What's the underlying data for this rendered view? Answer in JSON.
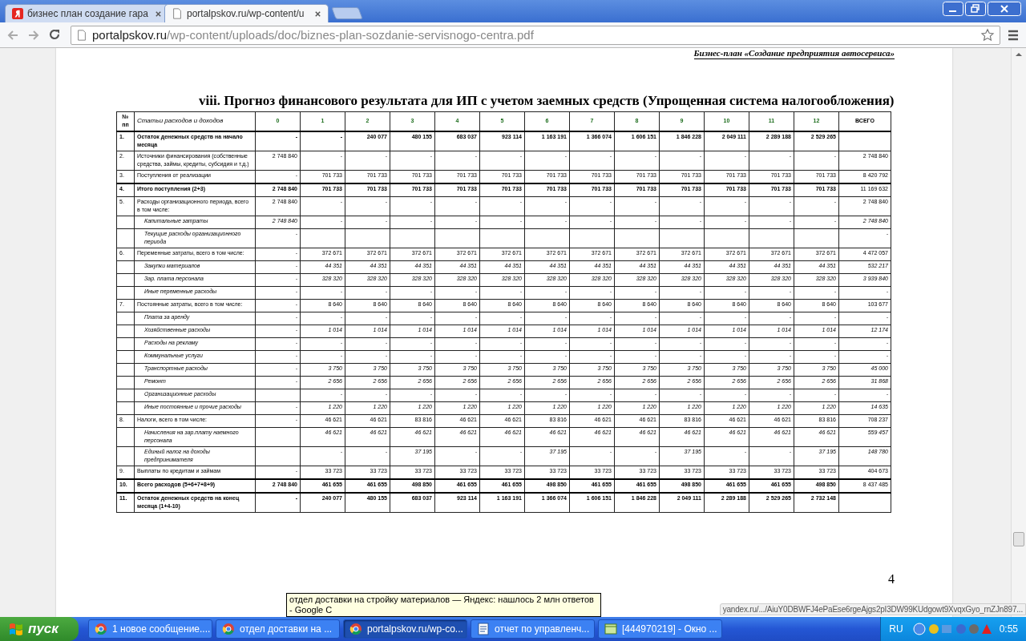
{
  "browser": {
    "tabs": [
      {
        "title": "бизнес план создание гара",
        "kind": "yandex",
        "selected": false
      },
      {
        "title": "portalpskov.ru/wp-content/u",
        "kind": "page",
        "selected": true
      }
    ],
    "address": {
      "host": "portalpskov.ru",
      "path": "/wp-content/uploads/doc/biznes-plan-sozdanie-servisnogo-centra.pdf"
    }
  },
  "document": {
    "running_header": "Бизнес-план «Создание предприятия автосервиса»",
    "title": "viii. Прогноз финансового результата для ИП с учетом заемных средств (Упрощенная система налогообложения)",
    "table": {
      "number_header": "№ пп",
      "label_header": "Статьи расходов и доходов",
      "columns": [
        "0",
        "1",
        "2",
        "3",
        "4",
        "5",
        "6",
        "7",
        "8",
        "9",
        "10",
        "11",
        "12"
      ],
      "total_header": "ВСЕГО",
      "rows": [
        {
          "number": "1.",
          "label": "Остаток денежных средств на начало месяца",
          "kind": "total",
          "values": [
            "-",
            "-",
            "240 077",
            "480 155",
            "683 037",
            "923 114",
            "1 163 191",
            "1 366 074",
            "1 606 151",
            "1 846 228",
            "2 049 111",
            "2 289 188",
            "2 529 265"
          ]
        },
        {
          "number": "2.",
          "label": "Источники финансирования (собственные средства, займы, кредиты, субсидия и т.д.)",
          "kind": "section",
          "values": [
            "2 748 840",
            "-",
            "-",
            "-",
            "-",
            "-",
            "-",
            "-",
            "-",
            "-",
            "-",
            "-",
            "-"
          ],
          "total": "2 748 840"
        },
        {
          "number": "3.",
          "label": "Поступления от реализации",
          "kind": "section",
          "values": [
            "-",
            "701 733",
            "701 733",
            "701 733",
            "701 733",
            "701 733",
            "701 733",
            "701 733",
            "701 733",
            "701 733",
            "701 733",
            "701 733",
            "701 733"
          ],
          "total": "8 420 792"
        },
        {
          "number": "4.",
          "label": "Итого поступления (2+3)",
          "kind": "total",
          "values": [
            "2 748 840",
            "701 733",
            "701 733",
            "701 733",
            "701 733",
            "701 733",
            "701 733",
            "701 733",
            "701 733",
            "701 733",
            "701 733",
            "701 733",
            "701 733"
          ],
          "total": "11 169 632"
        },
        {
          "number": "5.",
          "label": "Расходы организационного периода, всего в том числе:",
          "kind": "section",
          "values": [
            "2 748 840",
            "-",
            "-",
            "-",
            "-",
            "-",
            "-",
            "-",
            "-",
            "-",
            "-",
            "-",
            "-"
          ],
          "total": "2 748 840"
        },
        {
          "number": null,
          "label": "Капитальные затраты",
          "kind": "item",
          "values": [
            "2 748 840",
            "-",
            "-",
            "-",
            "-",
            "-",
            "-",
            "-",
            "-",
            "-",
            "-",
            "-",
            "-"
          ],
          "total": "2 748 840"
        },
        {
          "number": null,
          "label": "Текущие расходы организационного периода",
          "kind": "item",
          "values": [
            "-",
            {
              "blank": true
            },
            {
              "blank": true
            },
            {
              "blank": true
            },
            {
              "blank": true
            },
            {
              "blank": true
            },
            {
              "blank": true
            },
            {
              "blank": true
            },
            {
              "blank": true
            },
            {
              "blank": true
            },
            {
              "blank": true
            },
            {
              "blank": true
            },
            {
              "blank": true
            }
          ],
          "total": "-"
        },
        {
          "number": "6.",
          "label": "Переменные затраты, всего в том числе:",
          "kind": "section",
          "values": [
            "-",
            "372 671",
            "372 671",
            "372 671",
            "372 671",
            "372 671",
            "372 671",
            "372 671",
            "372 671",
            "372 671",
            "372 671",
            "372 671",
            "372 671"
          ],
          "total": "4 472 057"
        },
        {
          "number": null,
          "label": "Закупки материалов",
          "kind": "item",
          "values": [
            "-",
            "44 351",
            "44 351",
            "44 351",
            "44 351",
            "44 351",
            "44 351",
            "44 351",
            "44 351",
            "44 351",
            "44 351",
            "44 351",
            "44 351"
          ],
          "total": "532 217"
        },
        {
          "number": null,
          "label": "Зар. плата персонала",
          "kind": "item",
          "values": [
            "-",
            "328 320",
            "328 320",
            "328 320",
            "328 320",
            "328 320",
            "328 320",
            "328 320",
            "328 320",
            "328 320",
            "328 320",
            "328 320",
            "328 320"
          ],
          "total": "3 939 840"
        },
        {
          "number": null,
          "label": "Иные переменные расходы",
          "kind": "item",
          "values": [
            "-",
            "-",
            "-",
            "-",
            "-",
            "-",
            "-",
            "-",
            "-",
            "-",
            "-",
            "-",
            "-"
          ],
          "total": "-"
        },
        {
          "number": "7.",
          "label": "Постоянные затраты, всего в том числе:",
          "kind": "section",
          "values": [
            "-",
            "8 640",
            "8 640",
            "8 640",
            "8 640",
            "8 640",
            "8 640",
            "8 640",
            "8 640",
            "8 640",
            "8 640",
            "8 640",
            "8 640"
          ],
          "total": "103 677"
        },
        {
          "number": null,
          "label": "Плата за аренду",
          "kind": "item",
          "values": [
            "-",
            "-",
            "-",
            "-",
            "-",
            "-",
            "-",
            "-",
            "-",
            "-",
            "-",
            "-",
            "-"
          ],
          "total": "-"
        },
        {
          "number": null,
          "label": "Хозяйственные расходы",
          "kind": "item",
          "values": [
            "-",
            "1 014",
            "1 014",
            "1 014",
            "1 014",
            "1 014",
            "1 014",
            "1 014",
            "1 014",
            "1 014",
            "1 014",
            "1 014",
            "1 014"
          ],
          "total": "12 174"
        },
        {
          "number": null,
          "label": "Расходы на рекламу",
          "kind": "item",
          "values": [
            "-",
            "-",
            "-",
            "-",
            "-",
            "-",
            "-",
            "-",
            "-",
            "-",
            "-",
            "-",
            "-"
          ],
          "total": "-"
        },
        {
          "number": null,
          "label": "Коммунальные услуги",
          "kind": "item",
          "values": [
            "-",
            "-",
            "-",
            "-",
            "-",
            "-",
            "-",
            "-",
            "-",
            "-",
            "-",
            "-",
            "-"
          ],
          "total": "-"
        },
        {
          "number": null,
          "label": "Транспортные расходы",
          "kind": "item",
          "values": [
            "-",
            "3 750",
            "3 750",
            "3 750",
            "3 750",
            "3 750",
            "3 750",
            "3 750",
            "3 750",
            "3 750",
            "3 750",
            "3 750",
            "3 750"
          ],
          "total": "45 000"
        },
        {
          "number": null,
          "label": "Ремонт",
          "kind": "item",
          "values": [
            "-",
            "2 656",
            "2 656",
            "2 656",
            "2 656",
            "2 656",
            "2 656",
            "2 656",
            "2 656",
            "2 656",
            "2 656",
            "2 656",
            "2 656"
          ],
          "total": "31 868"
        },
        {
          "number": null,
          "label": "Организационные расходы",
          "kind": "item",
          "values": [
            {
              "blank": true
            },
            "-",
            "-",
            "-",
            "-",
            "-",
            "-",
            "-",
            "-",
            "-",
            "-",
            "-",
            "-"
          ],
          "total": "-"
        },
        {
          "number": null,
          "label": "Иные постоянные и прочие расходы",
          "kind": "item",
          "values": [
            "-",
            "1 220",
            "1 220",
            "1 220",
            "1 220",
            "1 220",
            "1 220",
            "1 220",
            "1 220",
            "1 220",
            "1 220",
            "1 220",
            "1 220"
          ],
          "total": "14 635"
        },
        {
          "number": "8.",
          "label": "Налоги, всего в том числе:",
          "kind": "section",
          "values": [
            "-",
            "46 621",
            "46 621",
            "83 816",
            "46 621",
            "46 621",
            "83 816",
            "46 621",
            "46 621",
            "83 816",
            "46 621",
            "46 621",
            "83 816"
          ],
          "total": "708 237"
        },
        {
          "number": null,
          "label": "Начисления на зар.плату наемного персонала",
          "kind": "item",
          "values": [
            {
              "blank": true
            },
            "46 621",
            "46 621",
            "46 621",
            "46 621",
            "46 621",
            "46 621",
            "46 621",
            "46 621",
            "46 621",
            "46 621",
            "46 621",
            "46 621"
          ],
          "total": "559 457"
        },
        {
          "number": null,
          "label": "Единый налог на доходы предпринимателя",
          "kind": "item",
          "values": [
            {
              "blank": true
            },
            "-",
            "-",
            "37 195",
            "-",
            "-",
            "37 195",
            "-",
            "-",
            "37 195",
            "-",
            "-",
            "37 195"
          ],
          "total": "148 780"
        },
        {
          "number": "9.",
          "label": "Выплаты по кредитам и займам",
          "kind": "section",
          "values": [
            "-",
            "33 723",
            "33 723",
            "33 723",
            "33 723",
            "33 723",
            "33 723",
            "33 723",
            "33 723",
            "33 723",
            "33 723",
            "33 723",
            "33 723"
          ],
          "total": "404 673"
        },
        {
          "number": "10.",
          "label": "Всего расходов (5+6+7+8+9)",
          "kind": "total",
          "values": [
            "2 748 840",
            "461 655",
            "461 655",
            "498 850",
            "461 655",
            "461 655",
            "498 850",
            "461 655",
            "461 655",
            "498 850",
            "461 655",
            "461 655",
            "498 850"
          ],
          "total": "8 437 485"
        },
        {
          "number": "11.",
          "label": "Остаток денежных средств на конец месяца (1+4-10)",
          "kind": "total",
          "values": [
            "-",
            "240 077",
            "480 155",
            "683 037",
            "923 114",
            "1 163 191",
            "1 366 074",
            "1 606 151",
            "1 846 228",
            "2 049 111",
            "2 289 188",
            "2 529 265",
            "2 732 148"
          ]
        }
      ]
    },
    "page_number": "4"
  },
  "tooltip": "отдел доставки на стройку материалов — Яндекс: нашлось 2 млн ответов - Google C",
  "status_url": "yandex.ru/.../AiuY0DBWFJ4ePaEse6rgeAjgs2pI3DW99KUdgowt9XvqxGyo_rnZJn897...",
  "taskbar": {
    "start": "пуск",
    "items": [
      {
        "label": "1 новое сообщение....",
        "kind": "chrome",
        "selected": false
      },
      {
        "label": "отдел доставки на ...",
        "kind": "chrome",
        "selected": false
      },
      {
        "label": "portalpskov.ru/wp-co...",
        "kind": "chrome",
        "selected": true
      },
      {
        "label": "отчет по управленч...",
        "kind": "word",
        "selected": false
      },
      {
        "label": "[444970219] - Окно ...",
        "kind": "app",
        "selected": false
      }
    ],
    "language": "RU",
    "clock": "0:55"
  }
}
